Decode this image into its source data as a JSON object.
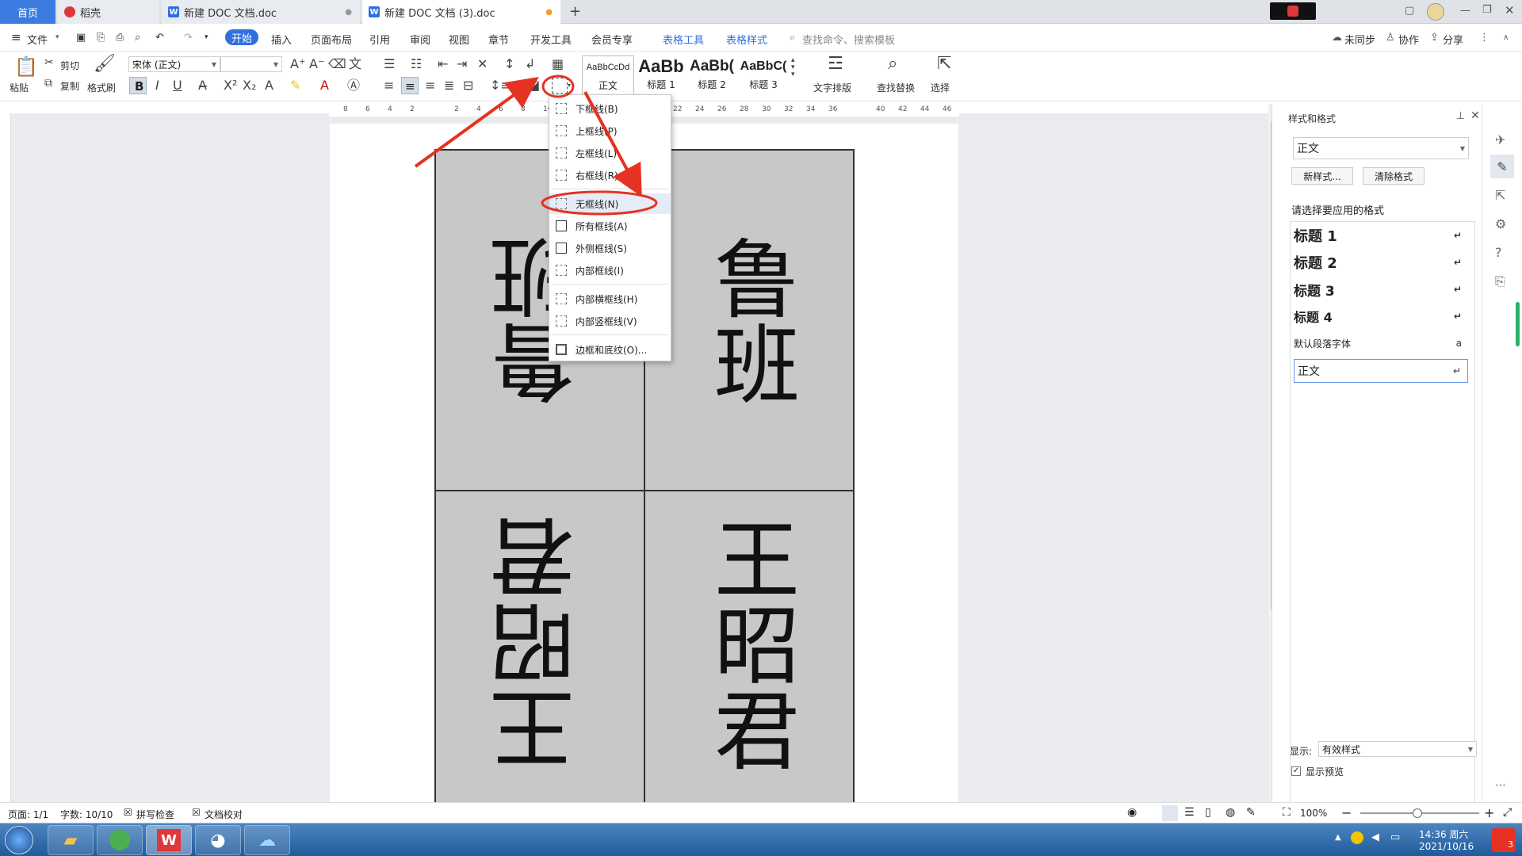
{
  "tabs": {
    "home": "首页",
    "daoke": "稻壳",
    "doc1": "新建 DOC 文档.doc",
    "doc3": "新建 DOC 文档 (3).doc",
    "new_tab": "+"
  },
  "menubar": {
    "file": "文件",
    "items": [
      "开始",
      "插入",
      "页面布局",
      "引用",
      "审阅",
      "视图",
      "章节",
      "开发工具",
      "会员专享"
    ],
    "context_tabs": [
      "表格工具",
      "表格样式"
    ],
    "search_placeholder": "查找命令、搜索模板",
    "sync": "未同步",
    "collab": "协作",
    "share": "分享"
  },
  "ribbon": {
    "paste": "粘贴",
    "cut": "剪切",
    "copy": "复制",
    "format_painter": "格式刷",
    "font_name": "宋体 (正文)",
    "font_size": "",
    "styles": [
      {
        "preview": "AaBbCcDd",
        "label": "正文"
      },
      {
        "preview": "AaBb",
        "label": "标题 1"
      },
      {
        "preview": "AaBb(",
        "label": "标题 2"
      },
      {
        "preview": "AaBbC(",
        "label": "标题 3"
      }
    ],
    "text_layout": "文字排版",
    "find_replace": "查找替换",
    "select": "选择"
  },
  "ruler": {
    "ticks": [
      "8",
      "6",
      "4",
      "2",
      "2",
      "4",
      "6",
      "8",
      "10",
      "22",
      "24",
      "26",
      "28",
      "30",
      "32",
      "34",
      "36",
      "40",
      "42",
      "44",
      "46"
    ]
  },
  "border_menu": {
    "items": [
      {
        "label": "下框线(B)"
      },
      {
        "label": "上框线(P)"
      },
      {
        "label": "左框线(L)"
      },
      {
        "label": "右框线(R)"
      },
      {
        "label": "无框线(N)"
      },
      {
        "label": "所有框线(A)"
      },
      {
        "label": "外侧框线(S)"
      },
      {
        "label": "内部框线(I)"
      },
      {
        "label": "内部横框线(H)"
      },
      {
        "label": "内部竖框线(V)"
      },
      {
        "label": "边框和底纹(O)..."
      }
    ]
  },
  "table": {
    "cells": [
      "鲁班",
      "鲁班",
      "王昭君",
      "王昭君"
    ]
  },
  "sidebar": {
    "title": "样式和格式",
    "current_style": "正文",
    "new_style": "新样式...",
    "clear_format": "清除格式",
    "prompt": "请选择要应用的格式",
    "styles": [
      "标题 1",
      "标题 2",
      "标题 3",
      "标题 4",
      "默认段落字体",
      "正文"
    ],
    "show_label": "显示:",
    "show_value": "有效样式",
    "preview_label": "显示预览"
  },
  "statusbar": {
    "page": "页面: 1/1",
    "words": "字数: 10/10",
    "spell": "拼写检查",
    "proof": "文档校对",
    "zoom": "100%"
  },
  "taskbar": {
    "time": "14:36 周六",
    "date": "2021/10/16",
    "badge": "3"
  },
  "colors": {
    "accent": "#2f6fe0",
    "annotation": "#e53222",
    "cell_fill": "#c8c8c8"
  }
}
